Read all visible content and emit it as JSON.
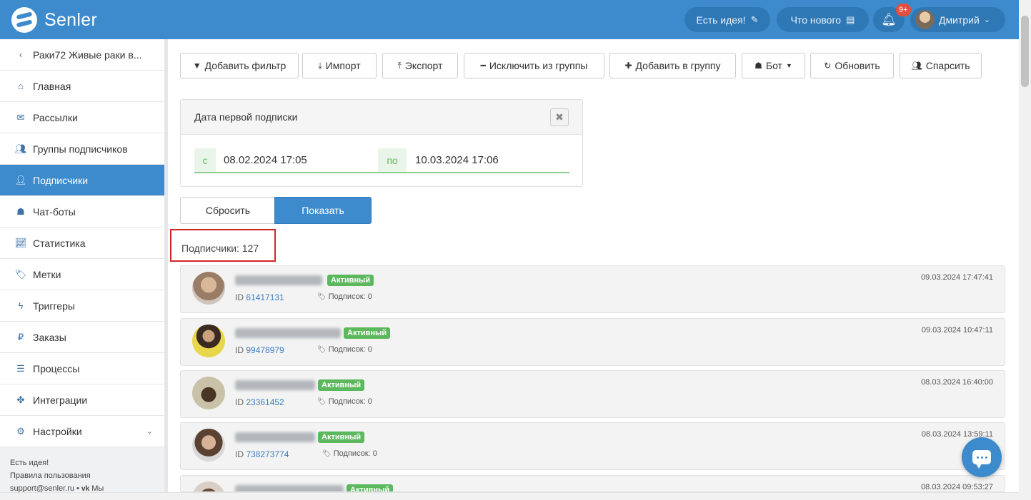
{
  "app": {
    "brand": "Senler",
    "accent": "#3d8bcd"
  },
  "topbar": {
    "idea_label": "Есть идея!",
    "idea_icon": "edit-icon",
    "news_label": "Что нового",
    "news_icon": "newspaper-icon",
    "notifications_badge": "9+",
    "user_name": "Дмитрий"
  },
  "sidebar": {
    "back_label": "Раки72 Живые раки в...",
    "items": [
      {
        "label": "Главная",
        "icon": "home-icon"
      },
      {
        "label": "Рассылки",
        "icon": "envelope-icon"
      },
      {
        "label": "Группы подписчиков",
        "icon": "users-icon"
      },
      {
        "label": "Подписчики",
        "icon": "user-icon",
        "active": true
      },
      {
        "label": "Чат-боты",
        "icon": "android-icon"
      },
      {
        "label": "Статистика",
        "icon": "chart-icon"
      },
      {
        "label": "Метки",
        "icon": "tag-icon"
      },
      {
        "label": "Триггеры",
        "icon": "bolt-icon"
      },
      {
        "label": "Заказы",
        "icon": "ruble-icon"
      },
      {
        "label": "Процессы",
        "icon": "list-icon"
      },
      {
        "label": "Интеграции",
        "icon": "puzzle-icon"
      },
      {
        "label": "Настройки",
        "icon": "gears-icon"
      }
    ],
    "footer": {
      "idea": "Есть идея!",
      "rules": "Правила пользования",
      "support": "support@senler.ru",
      "vk": "Мы"
    }
  },
  "toolbar": {
    "add_filter": "Добавить фильтр",
    "import": "Импорт",
    "export": "Экспорт",
    "exclude": "Исключить из группы",
    "add_group": "Добавить в группу",
    "bot": "Бот",
    "refresh": "Обновить",
    "parse": "Спарсить"
  },
  "filter": {
    "title": "Дата первой подписки",
    "from_prefix": "с",
    "from_value": "08.02.2024 17:05",
    "to_prefix": "по",
    "to_value": "10.03.2024 17:06"
  },
  "actions": {
    "reset": "Сбросить",
    "show": "Показать"
  },
  "count_label": "Подписчики: 127",
  "subscribers": [
    {
      "status": "Активный",
      "id_label": "ID",
      "id": "61417131",
      "subs": "Подписок: 0",
      "date": "09.03.2024 17:47:41"
    },
    {
      "status": "Активный",
      "id_label": "ID",
      "id": "99478979",
      "subs": "Подписок: 0",
      "date": "09.03.2024 10:47:11"
    },
    {
      "status": "Активный",
      "id_label": "ID",
      "id": "23361452",
      "subs": "Подписок: 0",
      "date": "08.03.2024 16:40:00"
    },
    {
      "status": "Активный",
      "id_label": "ID",
      "id": "738273774",
      "subs": "Подписок: 0",
      "date": "08.03.2024 13:59:11"
    },
    {
      "status": "Активный",
      "id_label": "ID",
      "id": "",
      "subs": "",
      "date": "08.03.2024 09:53:27"
    }
  ]
}
